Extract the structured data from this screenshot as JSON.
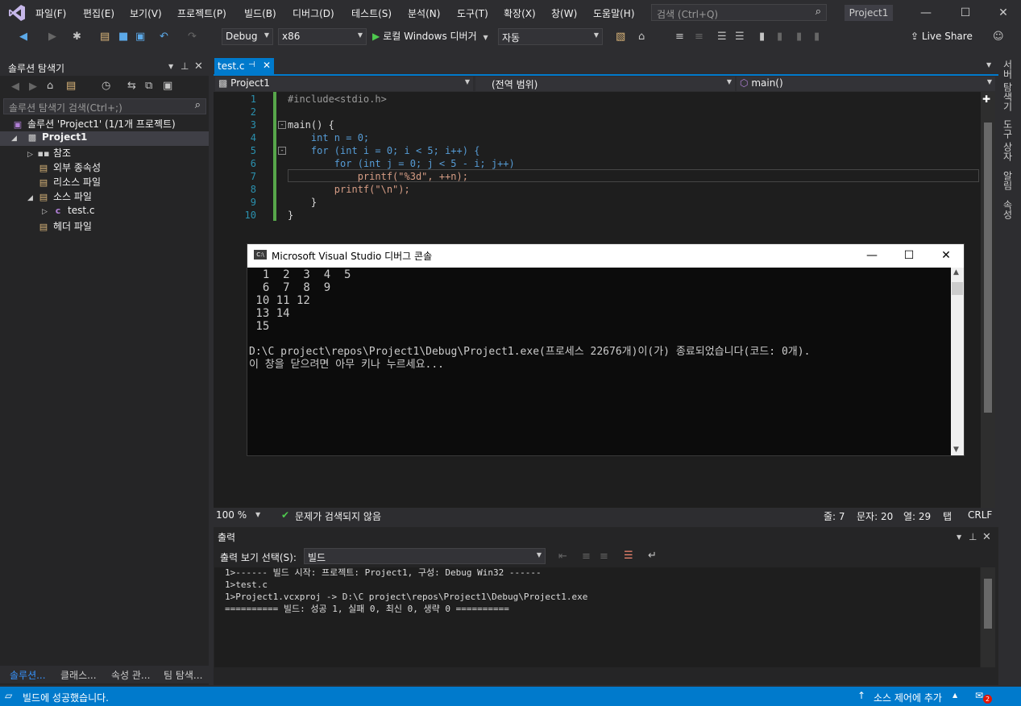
{
  "colors": {
    "accent": "#007acc",
    "editor_bg": "#1e1e1e",
    "keyword": "#569cd6",
    "string": "#d69d85",
    "line_number": "#2b91af",
    "success": "#4ec94e"
  },
  "menu": {
    "items": [
      "파일(F)",
      "편집(E)",
      "보기(V)",
      "프로젝트(P)",
      "빌드(B)",
      "디버그(D)",
      "테스트(S)",
      "분석(N)",
      "도구(T)",
      "확장(X)",
      "창(W)",
      "도움말(H)"
    ],
    "search_placeholder": "검색 (Ctrl+Q)",
    "project_name": "Project1"
  },
  "toolbar": {
    "config": "Debug",
    "platform": "x86",
    "run_label": "로컬 Windows 디버거",
    "run_mode": "자동",
    "live_share": "Live Share"
  },
  "solution_explorer": {
    "title": "솔루션 탐색기",
    "search_placeholder": "솔루션 탐색기 검색(Ctrl+;)",
    "tree": [
      {
        "label": "솔루션 'Project1' (1/1개 프로젝트)"
      },
      {
        "label": "Project1"
      },
      {
        "label": "참조"
      },
      {
        "label": "외부 종속성"
      },
      {
        "label": "리소스 파일"
      },
      {
        "label": "소스 파일"
      },
      {
        "label": "test.c"
      },
      {
        "label": "헤더 파일"
      }
    ],
    "bottom_tabs": [
      "솔루션...",
      "클래스...",
      "속성 관...",
      "팀 탐색..."
    ]
  },
  "editor": {
    "tab_label": "test.c",
    "nav": {
      "project": "Project1",
      "scope": "(전역 범위)",
      "member": "main()"
    },
    "lines": [
      {
        "n": "1",
        "text": "#include<stdio.h>"
      },
      {
        "n": "2",
        "text": ""
      },
      {
        "n": "3",
        "text": "main() {"
      },
      {
        "n": "4",
        "text": "    int n = 0;"
      },
      {
        "n": "5",
        "text": "    for (int i = 0; i < 5; i++) {"
      },
      {
        "n": "6",
        "text": "        for (int j = 0; j < 5 - i; j++)"
      },
      {
        "n": "7",
        "text": "            printf(\"%3d\", ++n);"
      },
      {
        "n": "8",
        "text": "        printf(\"\\n\");"
      },
      {
        "n": "9",
        "text": "    }"
      },
      {
        "n": "10",
        "text": "}"
      }
    ],
    "status": {
      "zoom": "100 %",
      "issues": "문제가 검색되지 않음",
      "line": "줄: 7",
      "char": "문자: 20",
      "col": "열: 29",
      "tab": "탭",
      "eol": "CRLF"
    }
  },
  "console": {
    "title": "Microsoft Visual Studio 디버그 콘솔",
    "lines": [
      "  1  2  3  4  5",
      "  6  7  8  9",
      " 10 11 12",
      " 13 14",
      " 15",
      "",
      "D:\\C project\\repos\\Project1\\Debug\\Project1.exe(프로세스 22676개)이(가) 종료되었습니다(코드: 0개).",
      "이 창을 닫으려면 아무 키나 누르세요..."
    ]
  },
  "output": {
    "title": "출력",
    "select_label": "출력 보기 선택(S):",
    "select_value": "빌드",
    "lines": [
      "1>------ 빌드 시작: 프로젝트: Project1, 구성: Debug Win32 ------",
      "1>test.c",
      "1>Project1.vcxproj -> D:\\C project\\repos\\Project1\\Debug\\Project1.exe",
      "========== 빌드: 성공 1, 실패 0, 최신 0, 생략 0 =========="
    ]
  },
  "right_tabs": [
    "서버 탐색기",
    "도구 상자",
    "알림",
    "속성"
  ],
  "statusbar": {
    "message": "빌드에 성공했습니다.",
    "source_control": "소스 제어에 추가",
    "notifications": "2"
  }
}
